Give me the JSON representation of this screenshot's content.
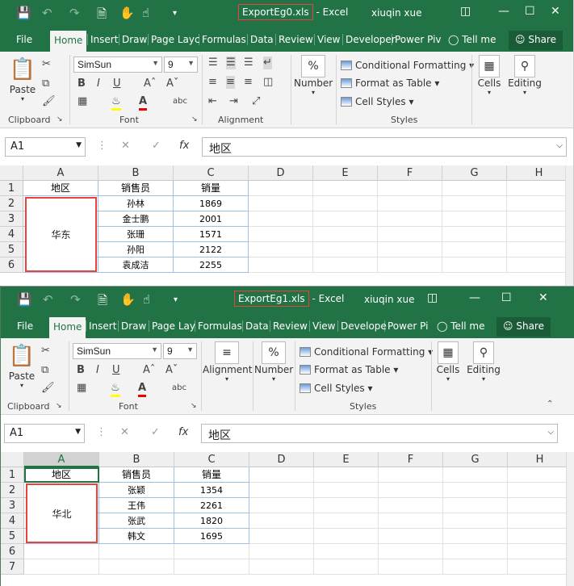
{
  "w1": {
    "title": {
      "file": "ExportEg0.xls",
      "app": "- Excel"
    },
    "user": "xiuqin xue",
    "tabs": [
      "File",
      "Home",
      "Insert",
      "Draw",
      "Page Layc",
      "Formulas",
      "Data",
      "Review",
      "View",
      "Developer",
      "Power Piv",
      "Tell me"
    ],
    "share": "Share",
    "font": {
      "name": "SimSun",
      "size": "9"
    },
    "groups": {
      "clipboard": "Clipboard",
      "font": "Font",
      "alignment": "Alignment",
      "styles": "Styles"
    },
    "paste": "Paste",
    "number": "Number",
    "cells": "Cells",
    "editing": "Editing",
    "styles": [
      "Conditional Formatting",
      "Format as Table",
      "Cell Styles"
    ],
    "namebox": "A1",
    "formula": "地区",
    "cols": [
      "A",
      "B",
      "C",
      "D",
      "E",
      "F",
      "G",
      "H"
    ],
    "rows": [
      "1",
      "2",
      "3",
      "4",
      "5",
      "6"
    ],
    "headers": [
      "地区",
      "销售员",
      "销量"
    ],
    "region": "华东",
    "data": [
      [
        "孙林",
        "1869"
      ],
      [
        "金士鹏",
        "2001"
      ],
      [
        "张珊",
        "1571"
      ],
      [
        "孙阳",
        "2122"
      ],
      [
        "袁成洁",
        "2255"
      ]
    ]
  },
  "w2": {
    "title": {
      "file": "ExportEg1.xls",
      "app": "- Excel"
    },
    "user": "xiuqin xue",
    "tabs": [
      "File",
      "Home",
      "Insert",
      "Draw",
      "Page Lay",
      "Formulas",
      "Data",
      "Review",
      "View",
      "Develope",
      "Power Pi",
      "Tell me"
    ],
    "share": "Share",
    "font": {
      "name": "SimSun",
      "size": "9"
    },
    "groups": {
      "clipboard": "Clipboard",
      "font": "Font",
      "styles": "Styles"
    },
    "paste": "Paste",
    "alignment": "Alignment",
    "number": "Number",
    "cells": "Cells",
    "editing": "Editing",
    "styles": [
      "Conditional Formatting",
      "Format as Table",
      "Cell Styles"
    ],
    "namebox": "A1",
    "formula": "地区",
    "cols": [
      "A",
      "B",
      "C",
      "D",
      "E",
      "F",
      "G",
      "H"
    ],
    "rows": [
      "1",
      "2",
      "3",
      "4",
      "5",
      "6",
      "7"
    ],
    "headers": [
      "地区",
      "销售员",
      "销量"
    ],
    "region": "华北",
    "data": [
      [
        "张颖",
        "1354"
      ],
      [
        "王伟",
        "2261"
      ],
      [
        "张武",
        "1820"
      ],
      [
        "韩文",
        "1695"
      ]
    ]
  },
  "colors": {
    "excel_green": "#217346",
    "highlight_red": "#e8423b",
    "table_border": "#9bc2e6"
  }
}
